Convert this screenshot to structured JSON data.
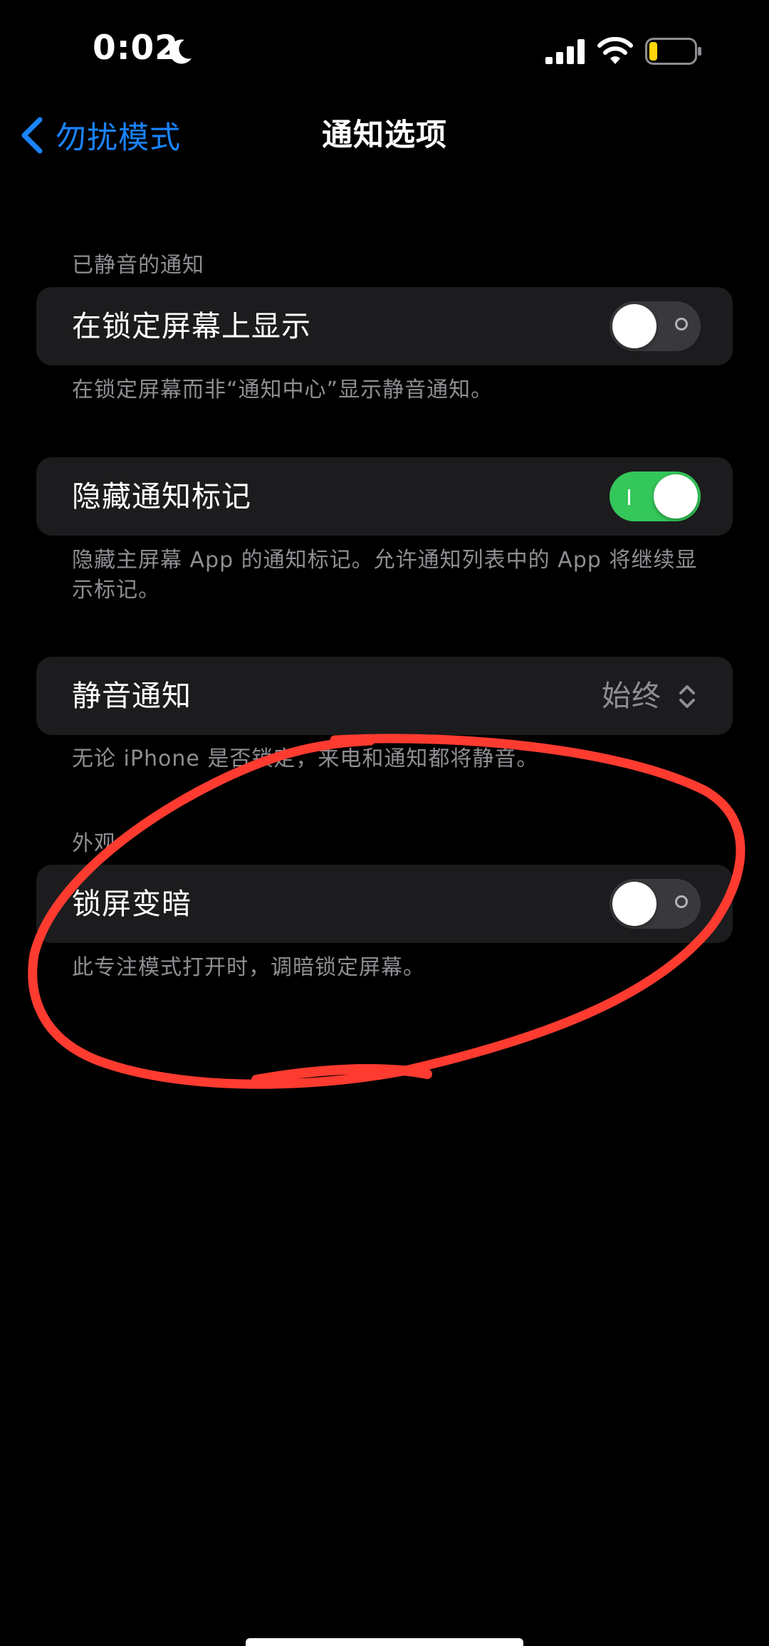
{
  "status_bar": {
    "time": "0:02",
    "icons": [
      "moon-icon",
      "signal-icon",
      "wifi-icon",
      "battery-icon"
    ],
    "battery_color": "#ffd60a"
  },
  "nav": {
    "back_label": "勿扰模式",
    "title": "通知选项"
  },
  "colors": {
    "accent": "#1a84ff",
    "toggle_on": "#34c759",
    "annotation": "#ff3b30"
  },
  "sections": {
    "silenced": {
      "header": "已静音的通知",
      "lock_screen": {
        "label": "在锁定屏幕上显示",
        "on": false,
        "footnote": "在锁定屏幕而非“通知中心”显示静音通知。"
      }
    },
    "badges": {
      "label": "隐藏通知标记",
      "on": true,
      "footnote": "隐藏主屏幕 App 的通知标记。允许通知列表中的 App 将继续显示标记。"
    },
    "silence": {
      "label": "静音通知",
      "value": "始终",
      "footnote": "无论 iPhone 是否锁定，来电和通知都将静音。"
    },
    "appearance": {
      "header": "外观",
      "dim_lock": {
        "label": "锁屏变暗",
        "on": false,
        "footnote": "此专注模式打开时，调暗锁定屏幕。"
      }
    }
  }
}
